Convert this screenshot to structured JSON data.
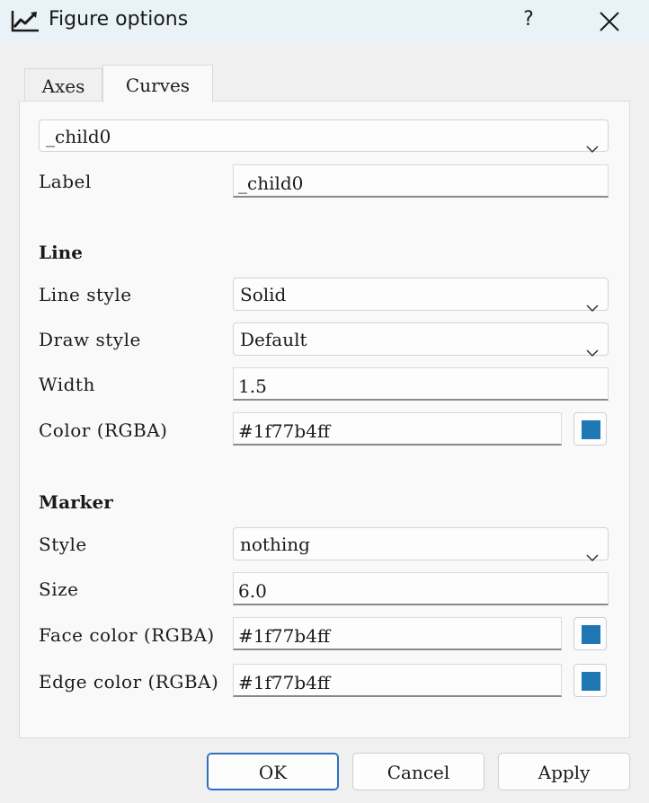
{
  "window": {
    "title": "Figure options",
    "title_icon": "line-chart-icon",
    "help_label": "?",
    "close_icon": "close-icon"
  },
  "tabs": [
    {
      "label": "Axes",
      "active": false
    },
    {
      "label": "Curves",
      "active": true
    }
  ],
  "curves": {
    "selected_curve": "_child0",
    "label_field": {
      "label": "Label",
      "value": "_child0"
    },
    "line_section": {
      "title": "Line",
      "line_style": {
        "label": "Line style",
        "value": "Solid"
      },
      "draw_style": {
        "label": "Draw style",
        "value": "Default"
      },
      "width": {
        "label": "Width",
        "value": "1.5"
      },
      "color": {
        "label": "Color (RGBA)",
        "value": "#1f77b4ff",
        "swatch": "#1f77b4"
      }
    },
    "marker_section": {
      "title": "Marker",
      "style": {
        "label": "Style",
        "value": "nothing"
      },
      "size": {
        "label": "Size",
        "value": "6.0"
      },
      "face_color": {
        "label": "Face color (RGBA)",
        "value": "#1f77b4ff",
        "swatch": "#1f77b4"
      },
      "edge_color": {
        "label": "Edge color (RGBA)",
        "value": "#1f77b4ff",
        "swatch": "#1f77b4"
      }
    }
  },
  "buttons": {
    "ok": "OK",
    "cancel": "Cancel",
    "apply": "Apply"
  },
  "colors": {
    "accent": "#2f6fbf",
    "titlebar_bg": "#e9f2f6"
  }
}
